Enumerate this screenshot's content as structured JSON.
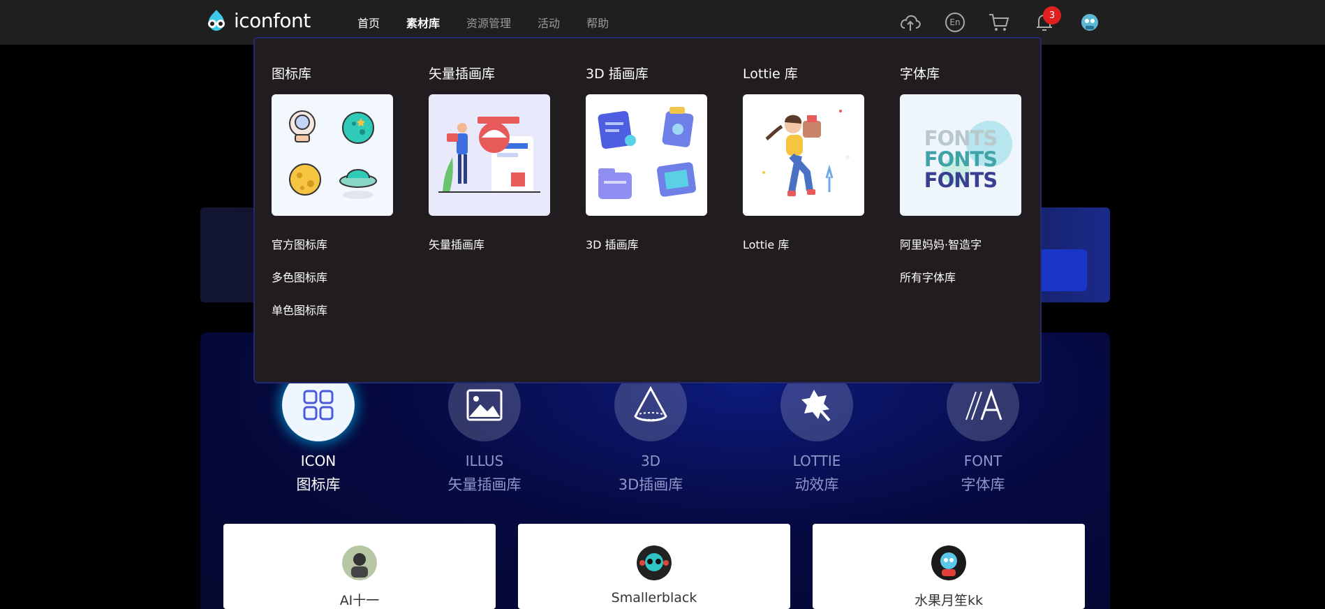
{
  "brand": {
    "name": "iconfont"
  },
  "nav": {
    "items": [
      {
        "label": "首页"
      },
      {
        "label": "素材库"
      },
      {
        "label": "资源管理"
      },
      {
        "label": "活动"
      },
      {
        "label": "帮助"
      }
    ],
    "notification_count": "3",
    "language_label": "En"
  },
  "dropdown": {
    "columns": [
      {
        "title": "图标库",
        "links": [
          "官方图标库",
          "多色图标库",
          "单色图标库"
        ]
      },
      {
        "title": "矢量插画库",
        "links": [
          "矢量插画库"
        ]
      },
      {
        "title": "3D 插画库",
        "links": [
          "3D 插画库"
        ]
      },
      {
        "title": "Lottie 库",
        "links": [
          "Lottie 库"
        ]
      },
      {
        "title": "字体库",
        "links": [
          "阿里妈妈·智造字",
          "所有字体库"
        ],
        "thumb_text": "FONTS"
      }
    ]
  },
  "categories": [
    {
      "en": "ICON",
      "cn": "图标库",
      "active": true
    },
    {
      "en": "ILLUS",
      "cn": "矢量插画库"
    },
    {
      "en": "3D",
      "cn": "3D插画库"
    },
    {
      "en": "LOTTIE",
      "cn": "动效库"
    },
    {
      "en": "FONT",
      "cn": "字体库"
    }
  ],
  "creators": [
    {
      "name": "AI十一"
    },
    {
      "name": "Smallerblack"
    },
    {
      "name": "水果月笙kk"
    }
  ],
  "colors": {
    "accent": "#23296e",
    "badge": "#e02020",
    "panel": "#060a42"
  }
}
